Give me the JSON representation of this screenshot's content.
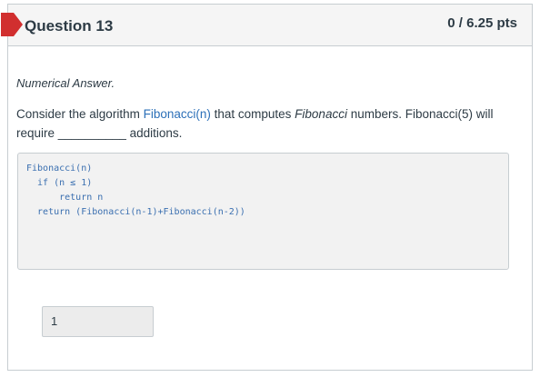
{
  "question": {
    "title": "Question 13",
    "points": "0 / 6.25 pts",
    "type_label": "Numerical Answer.",
    "prompt": {
      "part1": "Consider the algorithm ",
      "link_text": "Fibonacci(n)",
      "part2": " that computes ",
      "italic_word": "Fibonacci",
      "part3": " numbers. Fibonacci(5) will require __________ additions."
    },
    "code_lines": [
      "Fibonacci(n)",
      "  if (n ≤ 1)",
      "      return n",
      "  return (Fibonacci(n-1)+Fibonacci(n-2))"
    ],
    "answer_value": "1"
  },
  "colors": {
    "flag": "#d12f2f",
    "header_bg": "#f5f5f5",
    "link": "#2c70b8",
    "code_text": "#3a6fb0",
    "text": "#2d3b45"
  }
}
